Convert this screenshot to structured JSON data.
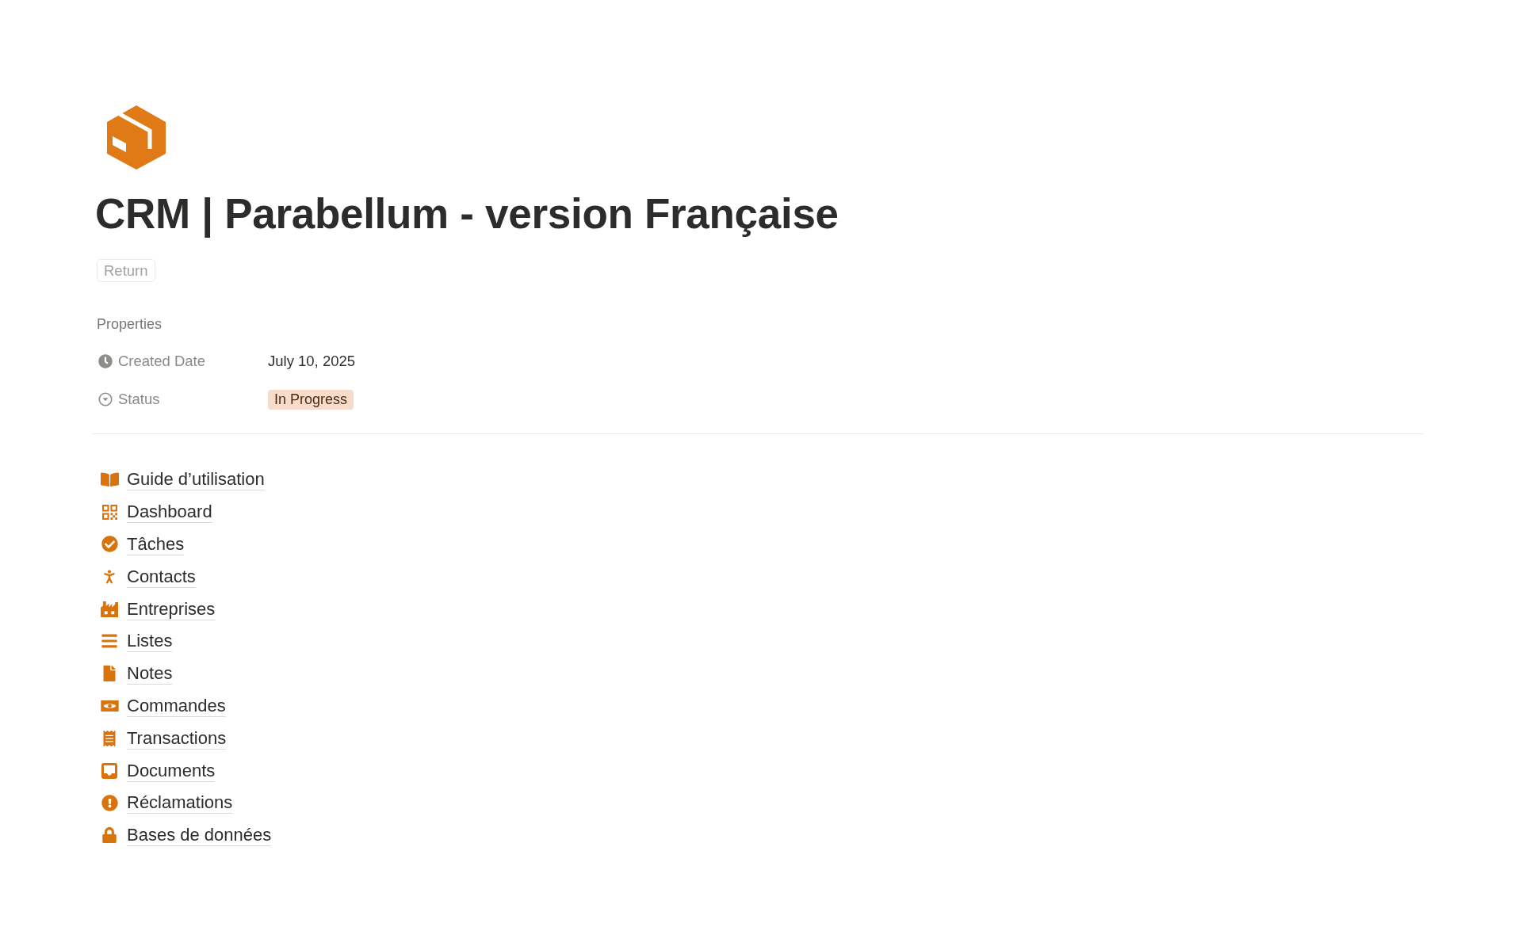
{
  "page": {
    "title": "CRM | Parabellum - version Française",
    "return_button": "Return"
  },
  "properties": {
    "heading": "Properties",
    "rows": [
      {
        "kind": "date",
        "label": "Created Date",
        "value": "July 10, 2025"
      },
      {
        "kind": "status",
        "label": "Status",
        "value": "In Progress"
      }
    ]
  },
  "links": [
    "Guide d’utilisation",
    "Dashboard",
    "Tâches",
    "Contacts",
    "Entreprises",
    "Listes",
    "Notes",
    "Commandes",
    "Transactions",
    "Documents",
    "Réclamations",
    "Bases de données"
  ]
}
